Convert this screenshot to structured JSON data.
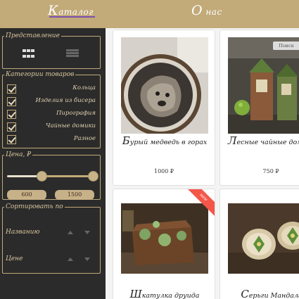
{
  "nav": {
    "catalog_cap": "К",
    "catalog_rest": "аталог",
    "about_cap": "О",
    "about_rest": "нас"
  },
  "sidebar": {
    "view": {
      "legend": "Представление",
      "grid_icon": "grid-icon",
      "list_icon": "list-icon"
    },
    "categories": {
      "legend": "Категории товаров",
      "items": [
        {
          "label": "Кольца",
          "checked": true
        },
        {
          "label": "Изделия из бисера",
          "checked": true
        },
        {
          "label": "Пирография",
          "checked": true
        },
        {
          "label": "Чайные домики",
          "checked": true
        },
        {
          "label": "Разное",
          "checked": true
        }
      ]
    },
    "price": {
      "legend": "Цена, ₽",
      "min": "600",
      "max": "1500"
    },
    "sort": {
      "legend": "Сортировать по",
      "options": [
        {
          "label": "Названию"
        },
        {
          "label": "Цене"
        }
      ]
    }
  },
  "products": [
    {
      "title_cap": "Б",
      "title_rest": "урый медведь в горах",
      "price": "1000 ₽",
      "badge": ""
    },
    {
      "title_cap": "Л",
      "title_rest": "есные чайные домики",
      "price": "750 ₽",
      "badge": "Поиск"
    },
    {
      "title_cap": "Ш",
      "title_rest": "катулка друида",
      "price": "",
      "badge": "new"
    },
    {
      "title_cap": "С",
      "title_rest": "ерьги Мандала",
      "price": "",
      "badge": ""
    }
  ],
  "colors": {
    "accent": "#c2aa79",
    "sidebar_bg": "#2b2b2b",
    "nav_underline": "#7a4fb0",
    "new_badge": "#f4574a"
  }
}
